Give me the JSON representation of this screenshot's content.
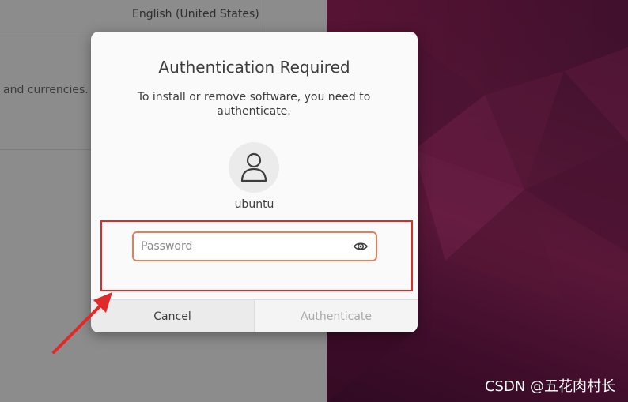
{
  "background_window": {
    "language_value": "English (United States)",
    "formats_description_partial": "and currencies."
  },
  "dialog": {
    "title": "Authentication Required",
    "message_line1": "To install or remove software, you need to",
    "message_line2": "authenticate.",
    "avatar_icon": "user-icon",
    "username": "ubuntu",
    "password": {
      "placeholder": "Password",
      "value": "",
      "reveal_icon": "eye-icon"
    },
    "buttons": {
      "cancel": "Cancel",
      "authenticate": "Authenticate"
    }
  },
  "watermark": "CSDN @五花肉村长",
  "colors": {
    "focus_ring": "#e77e5a",
    "annotation": "#e02a2a",
    "dialog_bg": "#fafafa"
  }
}
